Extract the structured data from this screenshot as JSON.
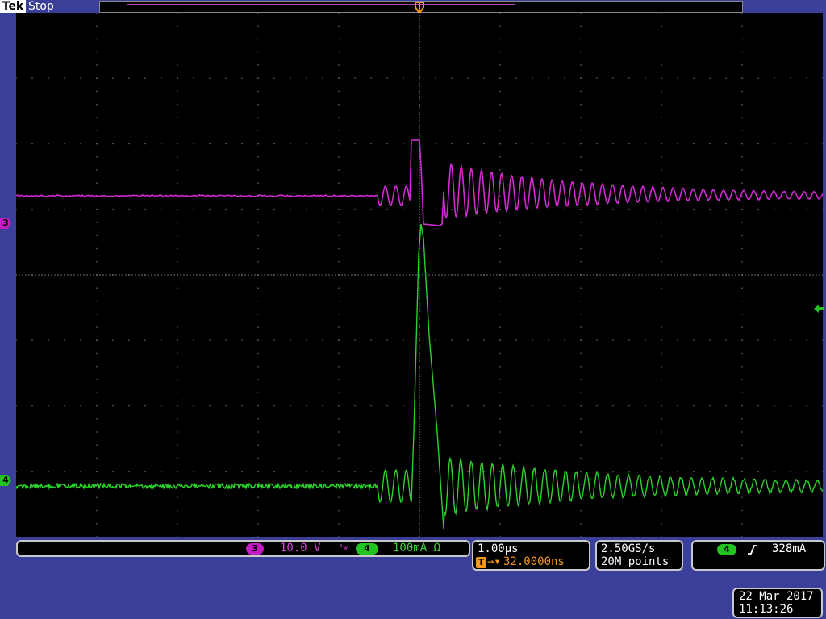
{
  "header": {
    "brand": "Tek",
    "status": "Stop"
  },
  "markers": {
    "trigger_position_label": "T",
    "ch3_label": "3",
    "ch4_label": "4"
  },
  "vertical": {
    "ch3": {
      "label": "3",
      "scale": "10.0 V",
      "color": "#c21cc2"
    },
    "bw_limit_icon": "bandwidth-limit-icon",
    "ch4": {
      "label": "4",
      "scale": "100mA Ω",
      "color": "#22c422"
    }
  },
  "horizontal": {
    "time_per_div": "1.00µs",
    "trigger_icon_label": "T",
    "delay": "32.0000ns"
  },
  "acquisition": {
    "sample_rate": "2.50GS/s",
    "record_length": "20M points"
  },
  "trigger": {
    "source_label": "4",
    "slope_icon": "rising-edge-icon",
    "level": "328mA"
  },
  "datetime": {
    "date": "22 Mar 2017",
    "time": "11:13:26"
  },
  "colors": {
    "background": "#3c3f99",
    "trigger_orange": "#f29a18",
    "ch3_magenta": "#c21cc2",
    "ch4_green": "#22c422"
  }
}
